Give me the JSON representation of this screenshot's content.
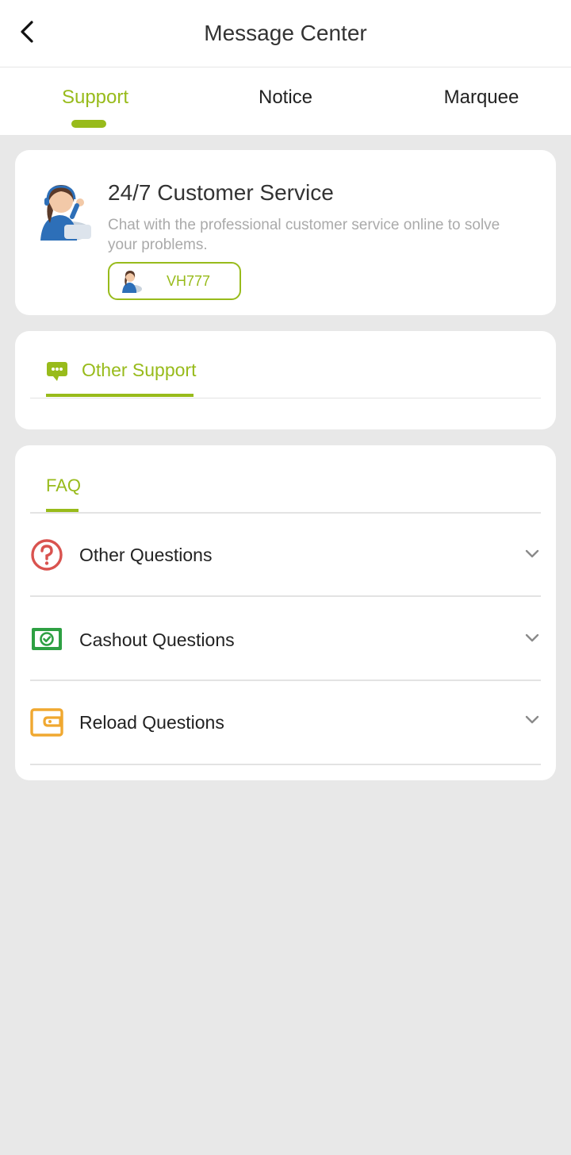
{
  "header": {
    "title": "Message Center",
    "back_icon": "chevron-left-icon"
  },
  "tabs": [
    {
      "label": "Support",
      "active": true
    },
    {
      "label": "Notice",
      "active": false
    },
    {
      "label": "Marquee",
      "active": false
    }
  ],
  "customer_service": {
    "title": "24/7 Customer Service",
    "description": "Chat with the professional customer service online to solve your problems.",
    "button_label": "VH777",
    "avatar_icon": "support-agent-avatar"
  },
  "other_support": {
    "tab_label": "Other Support",
    "icon": "chat-bubble-icon"
  },
  "faq": {
    "tab_label": "FAQ",
    "items": [
      {
        "label": "Other Questions",
        "icon": "question-circle-icon",
        "color": "#d9534f"
      },
      {
        "label": "Cashout Questions",
        "icon": "cash-check-icon",
        "color": "#2ea043"
      },
      {
        "label": "Reload Questions",
        "icon": "wallet-icon",
        "color": "#f0a830"
      }
    ]
  },
  "colors": {
    "accent": "#98bb1b",
    "background": "#e8e8e8",
    "card": "#ffffff",
    "muted_text": "#aaaaaa"
  }
}
